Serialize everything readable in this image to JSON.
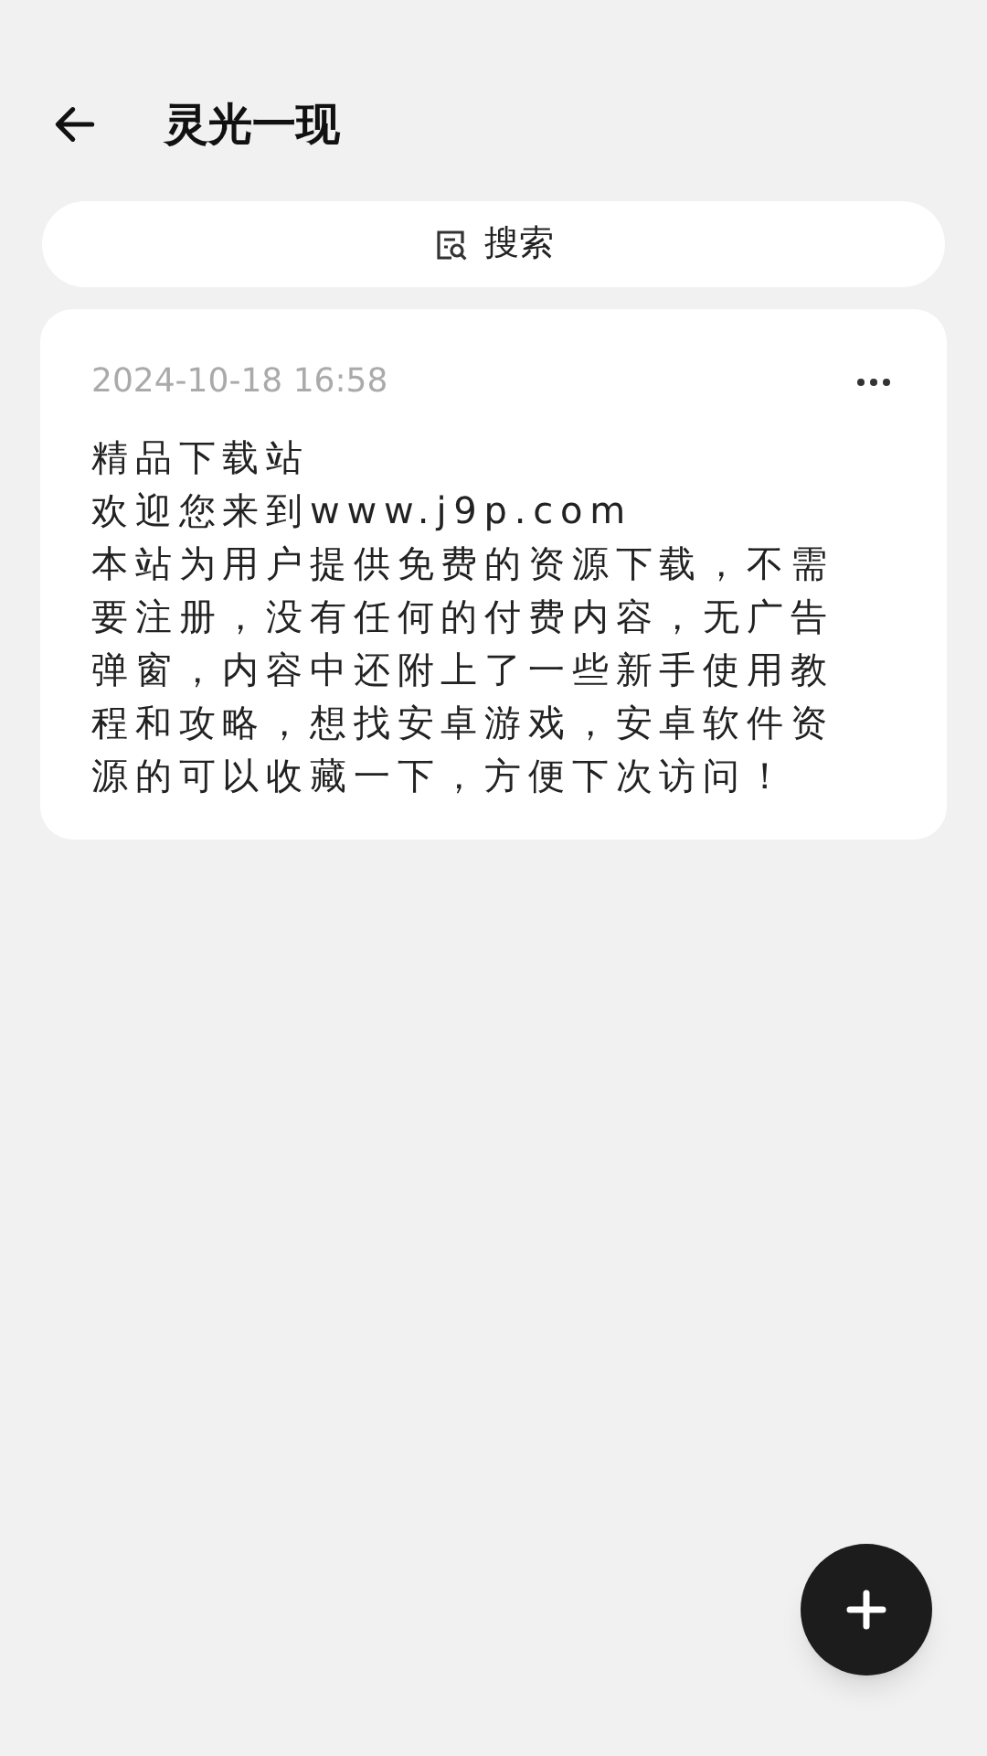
{
  "header": {
    "title": "灵光一现"
  },
  "search": {
    "label": "搜索"
  },
  "notes": [
    {
      "time": "2024-10-18 16:58",
      "lines": [
        "精品下载站",
        "欢迎您来到www.j9p.com",
        "本站为用户提供免费的资源下载，不需",
        "要注册，没有任何的付费内容，无广告",
        "弹窗，内容中还附上了一些新手使用教",
        "程和攻略，想找安卓游戏，安卓软件资",
        "源的可以收藏一下，方便下次访问！"
      ]
    }
  ]
}
